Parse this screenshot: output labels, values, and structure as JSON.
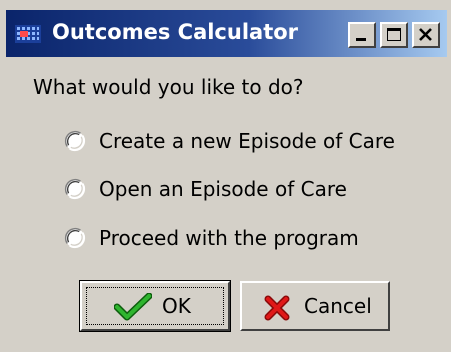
{
  "window": {
    "title": "Outcomes Calculator",
    "app_icon": "grid-app-icon",
    "caption_buttons": [
      "minimize-icon",
      "maximize-icon",
      "close-icon"
    ]
  },
  "dialog": {
    "prompt": "What would you like to do?",
    "options": [
      {
        "label": "Create a new Episode of Care",
        "selected": false
      },
      {
        "label": "Open an Episode of Care",
        "selected": false
      },
      {
        "label": "Proceed with the program",
        "selected": false
      }
    ]
  },
  "buttons": {
    "ok_label": "OK",
    "ok_icon": "green-checkmark-icon",
    "cancel_label": "Cancel",
    "cancel_icon": "red-x-icon"
  },
  "colors": {
    "face": "#d4d0c8",
    "title_start": "#0a246a",
    "title_end": "#a6caf0",
    "ok_check": "#1f9a1f",
    "cancel_x": "#cc1010"
  }
}
